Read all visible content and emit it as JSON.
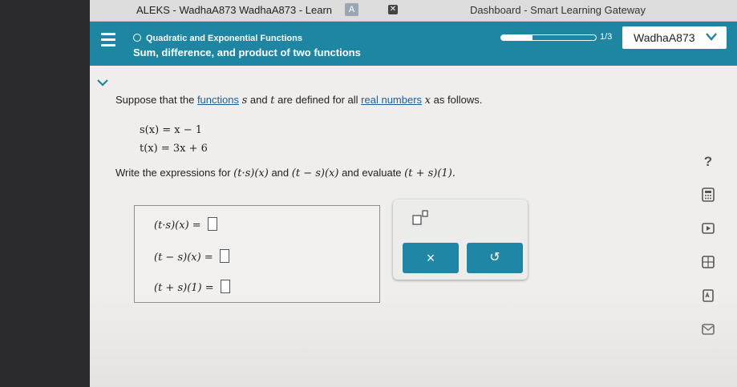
{
  "browser": {
    "tab_title": "ALEKS - WadhaA873 WadhaA873 - Learn",
    "tab_badge": "A",
    "second_window_title": "Dashboard - Smart Learning Gateway"
  },
  "header": {
    "topic": "Quadratic and Exponential Functions",
    "subtitle": "Sum, difference, and product of two functions",
    "progress": {
      "current": 1,
      "total": 3,
      "label": "1/3"
    },
    "username": "WadhaA873",
    "color": "#1e86a3"
  },
  "problem": {
    "prompt_a": "Suppose that the",
    "link_functions": "functions",
    "var_s": "s",
    "prompt_b": "and",
    "var_t": "t",
    "prompt_c": "are defined for all",
    "link_real_numbers": "real numbers",
    "var_x": "x",
    "prompt_d": "as follows.",
    "eq_s": "s(x) = x − 1",
    "eq_t": "t(x) = 3x + 6",
    "instruction_a": "Write the expressions for",
    "expr1": "(t·s)(x)",
    "instruction_b": "and",
    "expr2": "(t − s)(x)",
    "instruction_c": "and evaluate",
    "expr3": "(t + s)(1)."
  },
  "answers": [
    {
      "label": "(t·s)(x) =",
      "value": ""
    },
    {
      "label": "(t − s)(x) =",
      "value": ""
    },
    {
      "label": "(t + s)(1) =",
      "value": ""
    }
  ],
  "tools": {
    "clear_label": "×",
    "undo_label": "↺"
  },
  "sidebar": {
    "help_label": "?"
  }
}
